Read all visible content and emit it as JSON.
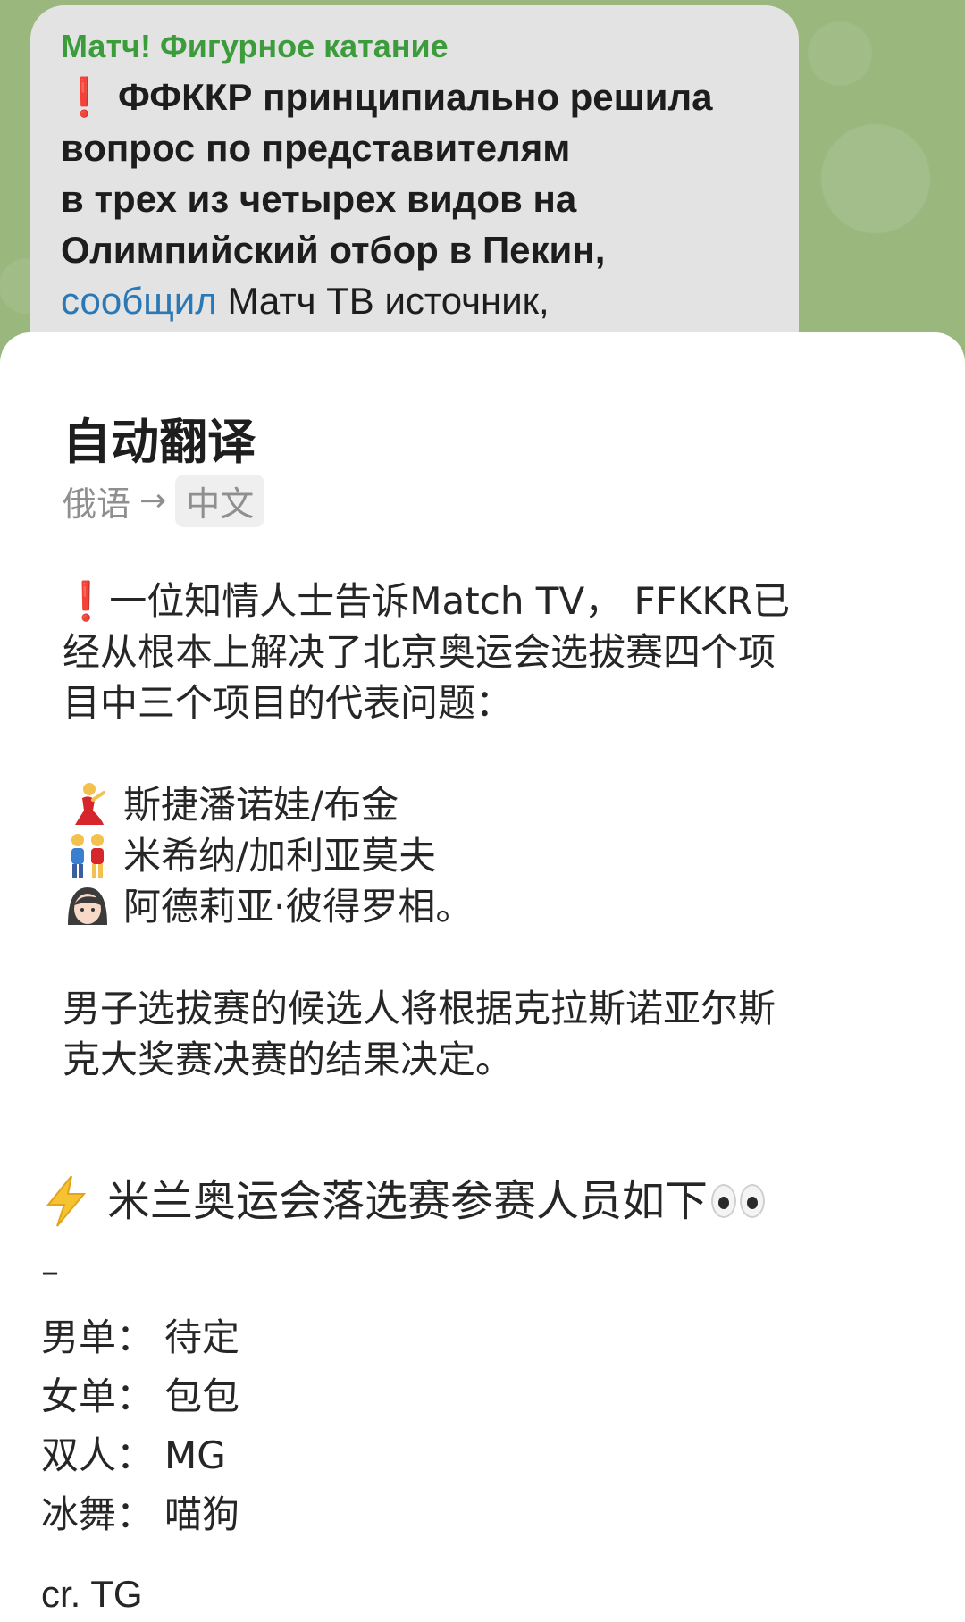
{
  "channel": {
    "name": "Матч! Фигурное катание",
    "message_lines": [
      "ФФККР принципиально решила",
      "вопрос по представителям",
      "в трех из четырех видов на",
      "Олимпийский отбор в Пекин,"
    ],
    "message_link": "сообщил",
    "message_tail": " Матч ТВ источник,"
  },
  "translation": {
    "title": "自动翻译",
    "source_lang": "俄语",
    "arrow": "→",
    "target_lang": "中文",
    "intro_line1": "一位知情人士告诉Match TV， FFKKR已",
    "intro_line2": "经从根本上解决了北京奥运会选拔赛四个项",
    "intro_line3": "目中三个项目的代表问题：",
    "entries": [
      {
        "icon": "dancer-icon",
        "text": "斯捷潘诺娃/布金"
      },
      {
        "icon": "couple-icon",
        "text": "米希纳/加利亚莫夫"
      },
      {
        "icon": "woman-icon",
        "text": "阿德莉亚·彼得罗相。"
      }
    ],
    "outro_line1": "男子选拔赛的候选人将根据克拉斯诺亚尔斯",
    "outro_line2": "克大奖赛决赛的结果决定。"
  },
  "post": {
    "title": "米兰奥运会落选赛参赛人员如下",
    "dash": "–",
    "roster": [
      {
        "label": "男单：",
        "value": "待定"
      },
      {
        "label": "女单：",
        "value": "包包"
      },
      {
        "label": "双人：",
        "value": "MG"
      },
      {
        "label": "冰舞：",
        "value": "喵狗"
      }
    ],
    "credit": "cr. TG"
  }
}
